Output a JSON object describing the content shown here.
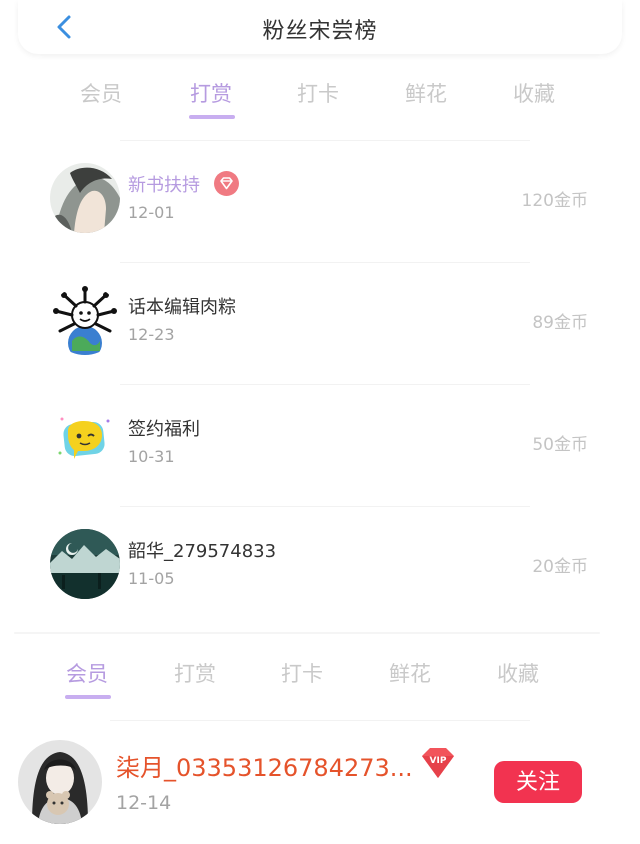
{
  "header": {
    "title": "粉丝宋尝榜"
  },
  "tabs_top": {
    "items": [
      {
        "label": "会员"
      },
      {
        "label": "打赏"
      },
      {
        "label": "打卡"
      },
      {
        "label": "鲜花"
      },
      {
        "label": "收藏"
      }
    ],
    "active": "打赏"
  },
  "list": [
    {
      "name": "新书扶持",
      "date": "12-01",
      "amount": "120金币",
      "badge": "diamond-badge-icon"
    },
    {
      "name": "话本编辑肉粽",
      "date": "12-23",
      "amount": "89金币"
    },
    {
      "name": "签约福利",
      "date": "10-31",
      "amount": "50金币"
    },
    {
      "name": "韶华_279574833",
      "date": "11-05",
      "amount": "20金币"
    }
  ],
  "tabs_bottom": {
    "items": [
      {
        "label": "会员"
      },
      {
        "label": "打赏"
      },
      {
        "label": "打卡"
      },
      {
        "label": "鲜花"
      },
      {
        "label": "收藏"
      }
    ],
    "active": "会员"
  },
  "member": {
    "name": "柒月_03353126784273...",
    "date": "12-14",
    "vip_label": "VIP",
    "follow_label": "关注"
  },
  "colors": {
    "accent": "#b69be0",
    "indicator": "#c8aef0",
    "follow_button": "#f23350",
    "member_name": "#e5532b",
    "badge": "#f07a82"
  }
}
